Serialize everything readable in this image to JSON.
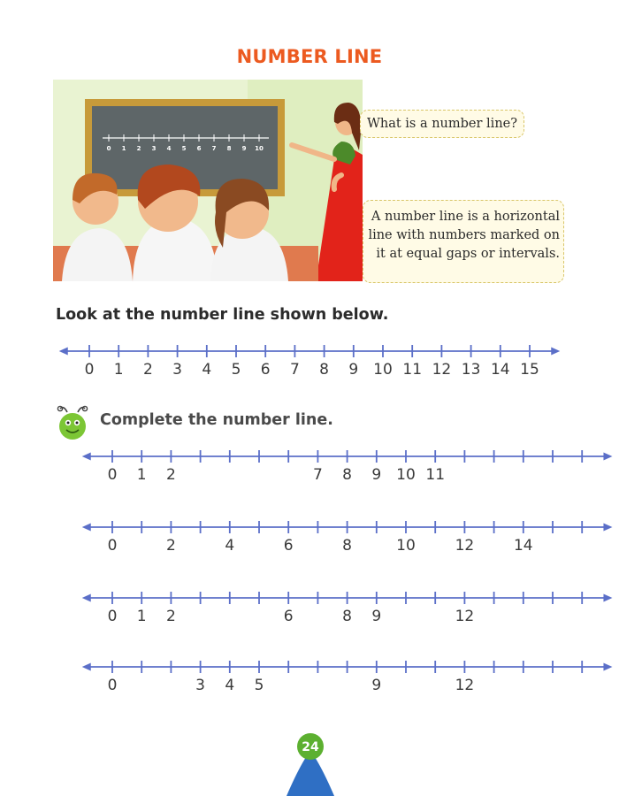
{
  "page": {
    "title": "NUMBER LINE",
    "page_number": "24"
  },
  "illustration": {
    "blackboard_numbers": [
      "0",
      "1",
      "2",
      "3",
      "4",
      "5",
      "6",
      "7",
      "8",
      "9",
      "10"
    ]
  },
  "speech": {
    "question": "What is a number line?",
    "answer_lines": [
      "A number line is a horizontal",
      "line with numbers marked on",
      "it at equal gaps or intervals."
    ]
  },
  "section1": {
    "heading": "Look at the number line shown below.",
    "labels": [
      "0",
      "1",
      "2",
      "3",
      "4",
      "5",
      "6",
      "7",
      "8",
      "9",
      "10",
      "11",
      "12",
      "13",
      "14",
      "15"
    ]
  },
  "section2": {
    "heading": "Complete the number line.",
    "lines": [
      {
        "labels": [
          "0",
          "1",
          "2",
          "",
          "",
          "",
          "",
          "7",
          "8",
          "9",
          "10",
          "11",
          "",
          "",
          "",
          "",
          ""
        ]
      },
      {
        "labels": [
          "0",
          "",
          "2",
          "",
          "4",
          "",
          "6",
          "",
          "8",
          "",
          "10",
          "",
          "12",
          "",
          "14",
          "",
          ""
        ]
      },
      {
        "labels": [
          "0",
          "1",
          "2",
          "",
          "",
          "",
          "6",
          "",
          "8",
          "9",
          "",
          "",
          "12",
          "",
          "",
          "",
          ""
        ]
      },
      {
        "labels": [
          "0",
          "",
          "",
          "3",
          "4",
          "5",
          "",
          "",
          "",
          "9",
          "",
          "",
          "12",
          "",
          "",
          "",
          ""
        ]
      }
    ]
  },
  "colors": {
    "title": "#ec5a20",
    "number_line": "#5b6fc8",
    "badge_green": "#5cb030",
    "badge_blue": "#2f6fc4"
  }
}
